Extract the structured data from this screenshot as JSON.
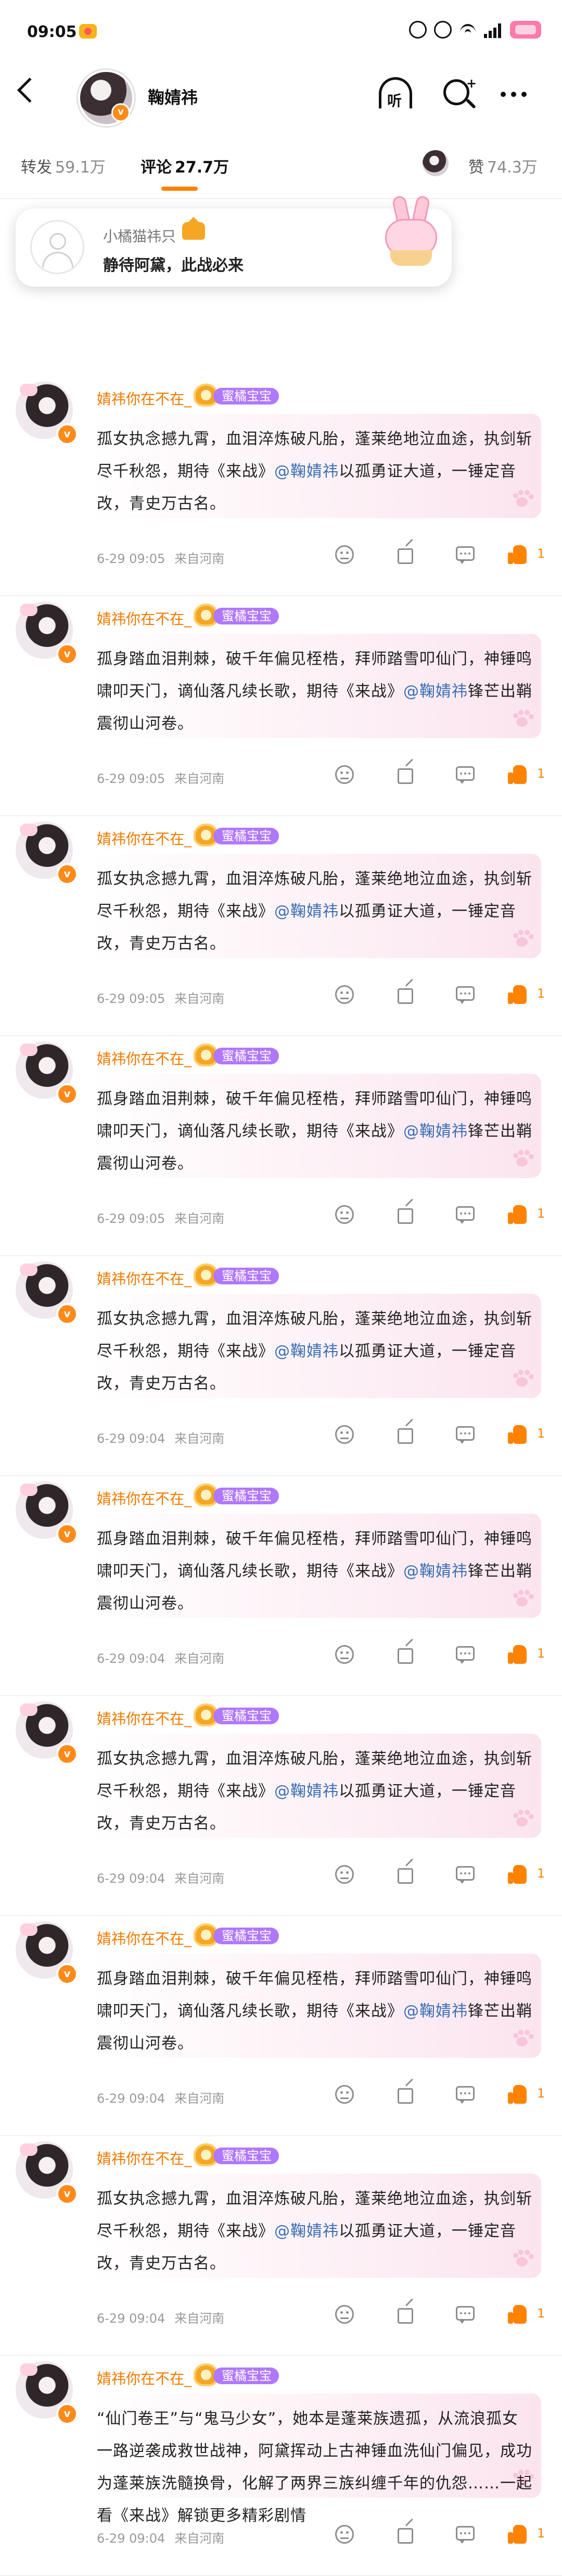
{
  "status_bar": {
    "time": "09:05"
  },
  "header": {
    "name": "鞠婧祎",
    "listen_label": "听"
  },
  "tabs": {
    "repost_label": "转发",
    "repost_count": "59.1万",
    "comment_label": "评论",
    "comment_count": "27.7万",
    "like_label": "赞",
    "like_count": "74.3万"
  },
  "floating_card": {
    "user": "小橘猫祎只",
    "message": "静待阿黛，此战必来"
  },
  "comments": [
    {
      "user": "婧祎你在不在_",
      "badge": "蜜橘宝宝",
      "text_a": "孤女执念撼九霄，血泪淬炼破凡胎，蓬莱绝地泣血途，执剑斩尽千秋怨，期待《来战》",
      "mention": "@鞠婧祎",
      "text_b": "以孤勇证大道，一锤定音改，青史万古名。",
      "date": "6-29 09:05",
      "location": "来自河南",
      "likes": "1"
    },
    {
      "user": "婧祎你在不在_",
      "badge": "蜜橘宝宝",
      "text_a": "孤身踏血泪荆棘，破千年偏见桎梏，拜师踏雪叩仙门，神锤鸣啸叩天门，谪仙落凡续长歌，期待《来战》",
      "mention": "@鞠婧祎",
      "text_b": "锋芒出鞘震彻山河卷。",
      "date": "6-29 09:05",
      "location": "来自河南",
      "likes": "1"
    },
    {
      "user": "婧祎你在不在_",
      "badge": "蜜橘宝宝",
      "text_a": "孤女执念撼九霄，血泪淬炼破凡胎，蓬莱绝地泣血途，执剑斩尽千秋怨，期待《来战》",
      "mention": "@鞠婧祎",
      "text_b": "以孤勇证大道，一锤定音改，青史万古名。",
      "date": "6-29 09:05",
      "location": "来自河南",
      "likes": "1"
    },
    {
      "user": "婧祎你在不在_",
      "badge": "蜜橘宝宝",
      "text_a": "孤身踏血泪荆棘，破千年偏见桎梏，拜师踏雪叩仙门，神锤鸣啸叩天门，谪仙落凡续长歌，期待《来战》",
      "mention": "@鞠婧祎",
      "text_b": "锋芒出鞘震彻山河卷。",
      "date": "6-29 09:05",
      "location": "来自河南",
      "likes": "1"
    },
    {
      "user": "婧祎你在不在_",
      "badge": "蜜橘宝宝",
      "text_a": "孤女执念撼九霄，血泪淬炼破凡胎，蓬莱绝地泣血途，执剑斩尽千秋怨，期待《来战》",
      "mention": "@鞠婧祎",
      "text_b": "以孤勇证大道，一锤定音改，青史万古名。",
      "date": "6-29 09:04",
      "location": "来自河南",
      "likes": "1"
    },
    {
      "user": "婧祎你在不在_",
      "badge": "蜜橘宝宝",
      "text_a": "孤身踏血泪荆棘，破千年偏见桎梏，拜师踏雪叩仙门，神锤鸣啸叩天门，谪仙落凡续长歌，期待《来战》",
      "mention": "@鞠婧祎",
      "text_b": "锋芒出鞘震彻山河卷。",
      "date": "6-29 09:04",
      "location": "来自河南",
      "likes": "1"
    },
    {
      "user": "婧祎你在不在_",
      "badge": "蜜橘宝宝",
      "text_a": "孤女执念撼九霄，血泪淬炼破凡胎，蓬莱绝地泣血途，执剑斩尽千秋怨，期待《来战》",
      "mention": "@鞠婧祎",
      "text_b": "以孤勇证大道，一锤定音改，青史万古名。",
      "date": "6-29 09:04",
      "location": "来自河南",
      "likes": "1"
    },
    {
      "user": "婧祎你在不在_",
      "badge": "蜜橘宝宝",
      "text_a": "孤身踏血泪荆棘，破千年偏见桎梏，拜师踏雪叩仙门，神锤鸣啸叩天门，谪仙落凡续长歌，期待《来战》",
      "mention": "@鞠婧祎",
      "text_b": "锋芒出鞘震彻山河卷。",
      "date": "6-29 09:04",
      "location": "来自河南",
      "likes": "1"
    },
    {
      "user": "婧祎你在不在_",
      "badge": "蜜橘宝宝",
      "text_a": "孤女执念撼九霄，血泪淬炼破凡胎，蓬莱绝地泣血途，执剑斩尽千秋怨，期待《来战》",
      "mention": "@鞠婧祎",
      "text_b": "以孤勇证大道，一锤定音改，青史万古名。",
      "date": "6-29 09:04",
      "location": "来自河南",
      "likes": "1"
    },
    {
      "user": "婧祎你在不在_",
      "badge": "蜜橘宝宝",
      "text_a": "“仙门卷王”与“鬼马少女”，她本是蓬莱族遗孤，从流浪孤女一路逆袭成救世战神，阿黛挥动上古神锤血洗仙门偏见，成功为蓬莱族洗髓换骨，化解了两界三族纠缠千年的仇怨……一起看《来战》解锁更多精彩剧情",
      "mention": "",
      "text_b": "",
      "date": "6-29 09:04",
      "location": "来自河南",
      "likes": "1"
    }
  ]
}
